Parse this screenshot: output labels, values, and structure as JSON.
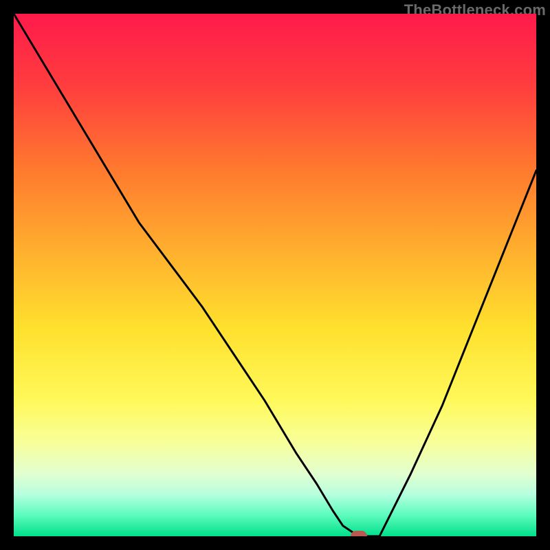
{
  "watermark": "TheBottleneck.com",
  "chart_data": {
    "type": "line",
    "title": "",
    "xlabel": "",
    "ylabel": "",
    "xlim": [
      0,
      100
    ],
    "ylim": [
      0,
      100
    ],
    "grid": false,
    "legend": false,
    "background": {
      "kind": "vertical-gradient",
      "stops": [
        {
          "pct": 0,
          "color": "#ff1a4b"
        },
        {
          "pct": 14,
          "color": "#ff3e3e"
        },
        {
          "pct": 30,
          "color": "#ff7a2e"
        },
        {
          "pct": 45,
          "color": "#ffae2e"
        },
        {
          "pct": 60,
          "color": "#ffe02d"
        },
        {
          "pct": 74,
          "color": "#fff95a"
        },
        {
          "pct": 82,
          "color": "#f8ff9a"
        },
        {
          "pct": 88,
          "color": "#e2ffcf"
        },
        {
          "pct": 92,
          "color": "#b6ffdf"
        },
        {
          "pct": 96,
          "color": "#5bfcbc"
        },
        {
          "pct": 100,
          "color": "#00e08a"
        }
      ]
    },
    "series": [
      {
        "name": "bottleneck-curve",
        "color": "#000000",
        "width": 3,
        "x": [
          0,
          6,
          12,
          18,
          24,
          30,
          36,
          42,
          48,
          54,
          58,
          61,
          63,
          66,
          70,
          76,
          82,
          88,
          94,
          100
        ],
        "y": [
          100,
          90,
          80,
          70,
          60,
          52,
          44,
          35,
          26,
          16,
          10,
          5,
          2,
          0,
          0,
          12,
          25,
          40,
          55,
          70
        ]
      }
    ],
    "marker": {
      "x": 66,
      "y": 0,
      "color": "#b9594f"
    }
  }
}
